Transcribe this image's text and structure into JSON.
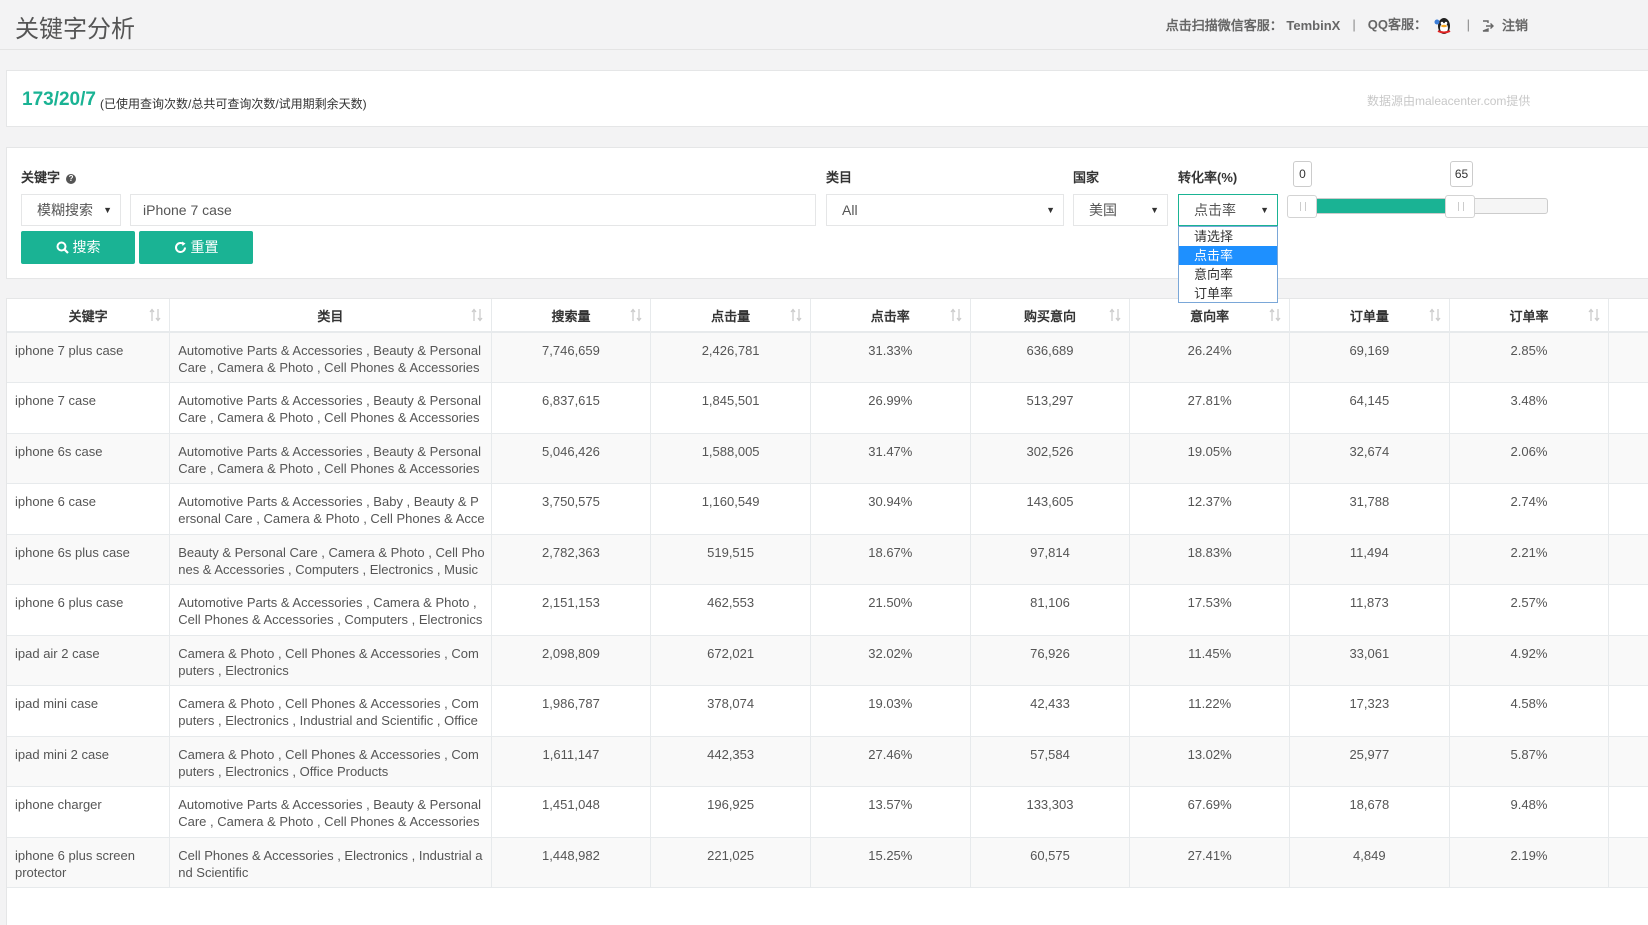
{
  "header": {
    "title": "关键字分析",
    "wechat_label": "点击扫描微信客服：",
    "wechat_id": "TembinX",
    "qq_label": "QQ客服：",
    "logout_label": "注销"
  },
  "usage": {
    "count": "173/20/7",
    "description": "(已使用查询次数/总共可查询次数/试用期剩余天数)",
    "data_source": "数据源由maleacenter.com提供"
  },
  "filters": {
    "keyword_label": "关键字",
    "match_mode": "模糊搜索",
    "keyword_value": "iPhone 7 case",
    "category_label": "类目",
    "category_value": "All",
    "country_label": "国家",
    "country_value": "美国",
    "conversion_label": "转化率(%)",
    "conversion_type": "点击率",
    "conversion_options": [
      "请选择",
      "点击率",
      "意向率",
      "订单率"
    ],
    "range_min": "0",
    "range_max": "65",
    "search_label": "搜索",
    "reset_label": "重置"
  },
  "slider": {
    "low": 0,
    "high": 65,
    "max": 100
  },
  "table": {
    "columns": [
      "关键字",
      "类目",
      "搜索量",
      "点击量",
      "点击率",
      "购买意向",
      "意向率",
      "订单量",
      "订单率"
    ],
    "rows": [
      [
        "iphone 7 plus case",
        "Automotive Parts & Accessories , Beauty & Personal Care , Camera & Photo , Cell Phones & Accessories",
        "7,746,659",
        "2,426,781",
        "31.33%",
        "636,689",
        "26.24%",
        "69,169",
        "2.85%"
      ],
      [
        "iphone 7 case",
        "Automotive Parts & Accessories , Beauty & Personal Care , Camera & Photo , Cell Phones & Accessories",
        "6,837,615",
        "1,845,501",
        "26.99%",
        "513,297",
        "27.81%",
        "64,145",
        "3.48%"
      ],
      [
        "iphone 6s case",
        "Automotive Parts & Accessories , Beauty & Personal Care , Camera & Photo , Cell Phones & Accessories",
        "5,046,426",
        "1,588,005",
        "31.47%",
        "302,526",
        "19.05%",
        "32,674",
        "2.06%"
      ],
      [
        "iphone 6 case",
        "Automotive Parts & Accessories , Baby , Beauty & Personal Care , Camera & Photo , Cell Phones & Acce",
        "3,750,575",
        "1,160,549",
        "30.94%",
        "143,605",
        "12.37%",
        "31,788",
        "2.74%"
      ],
      [
        "iphone 6s plus case",
        "Beauty & Personal Care , Camera & Photo , Cell Phones & Accessories , Computers , Electronics , Music",
        "2,782,363",
        "519,515",
        "18.67%",
        "97,814",
        "18.83%",
        "11,494",
        "2.21%"
      ],
      [
        "iphone 6 plus case",
        "Automotive Parts & Accessories , Camera & Photo , Cell Phones & Accessories , Computers , Electronics",
        "2,151,153",
        "462,553",
        "21.50%",
        "81,106",
        "17.53%",
        "11,873",
        "2.57%"
      ],
      [
        "ipad air 2 case",
        "Camera & Photo , Cell Phones & Accessories , Computers , Electronics",
        "2,098,809",
        "672,021",
        "32.02%",
        "76,926",
        "11.45%",
        "33,061",
        "4.92%"
      ],
      [
        "ipad mini case",
        "Camera & Photo , Cell Phones & Accessories , Computers , Electronics , Industrial and Scientific , Office",
        "1,986,787",
        "378,074",
        "19.03%",
        "42,433",
        "11.22%",
        "17,323",
        "4.58%"
      ],
      [
        "ipad mini 2 case",
        "Camera & Photo , Cell Phones & Accessories , Computers , Electronics , Office Products",
        "1,611,147",
        "442,353",
        "27.46%",
        "57,584",
        "13.02%",
        "25,977",
        "5.87%"
      ],
      [
        "iphone charger",
        "Automotive Parts & Accessories , Beauty & Personal Care , Camera & Photo , Cell Phones & Accessories",
        "1,451,048",
        "196,925",
        "13.57%",
        "133,303",
        "67.69%",
        "18,678",
        "9.48%"
      ],
      [
        "iphone 6 plus screen protector",
        "Cell Phones & Accessories , Electronics , Industrial and Scientific",
        "1,448,982",
        "221,025",
        "15.25%",
        "60,575",
        "27.41%",
        "4,849",
        "2.19%"
      ]
    ]
  }
}
